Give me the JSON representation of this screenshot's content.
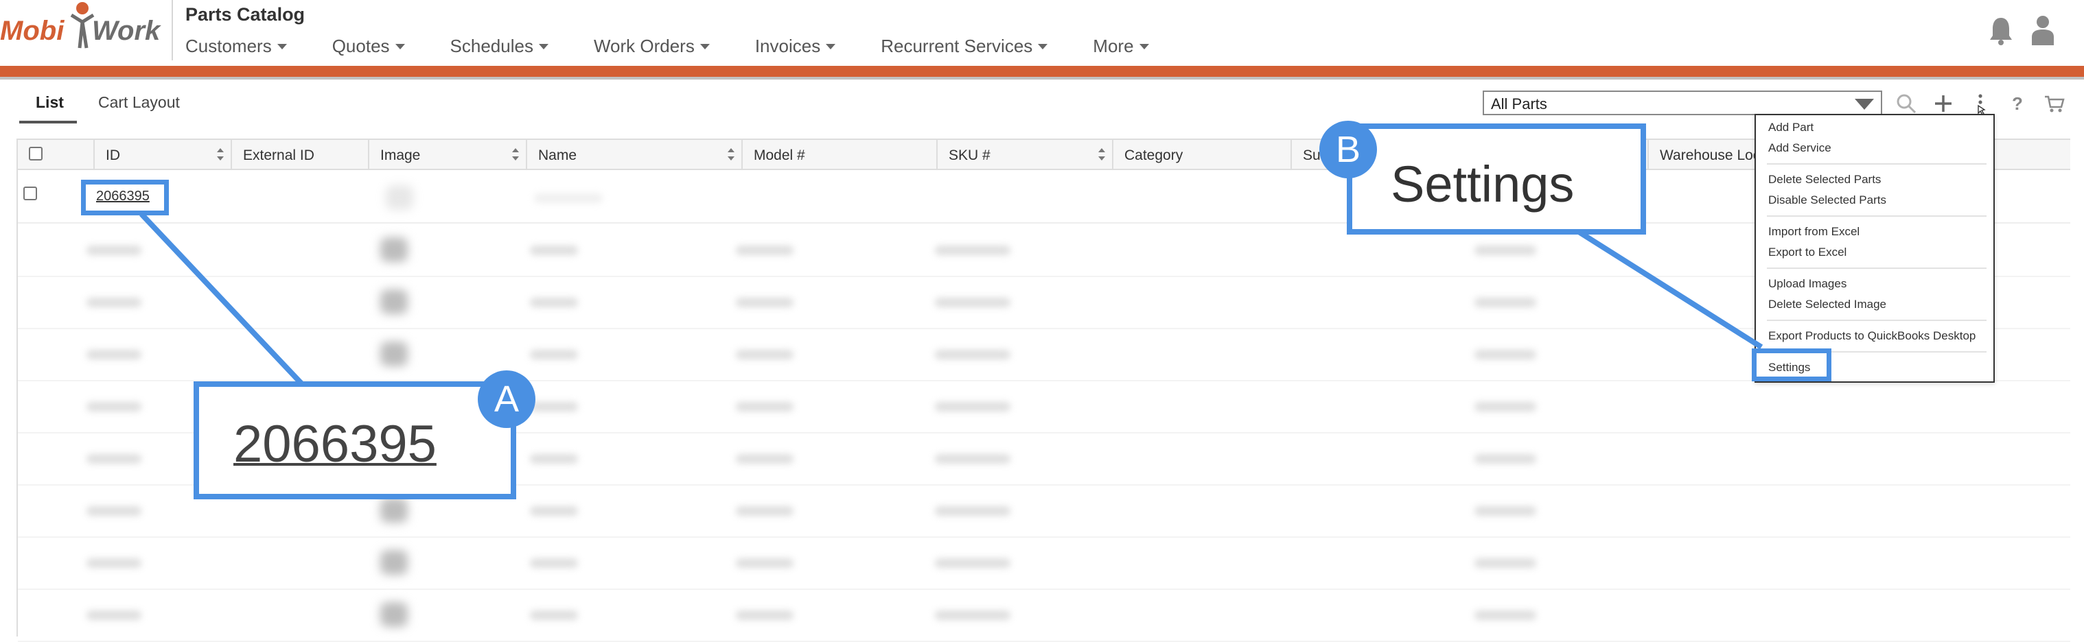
{
  "header": {
    "logo_text_left": "Mobi",
    "logo_text_right": "Work",
    "page_title": "Parts Catalog",
    "nav": [
      "Customers",
      "Quotes",
      "Schedules",
      "Work Orders",
      "Invoices",
      "Recurrent Services",
      "More"
    ]
  },
  "toolbar": {
    "tabs": [
      "List",
      "Cart Layout"
    ],
    "filter_value": "All Parts",
    "icons": [
      "search-icon",
      "plus-icon",
      "more-vertical-icon",
      "help-icon",
      "cart-icon"
    ]
  },
  "table": {
    "columns": [
      "ID",
      "External ID",
      "Image",
      "Name",
      "Model #",
      "SKU #",
      "Category",
      "Sub",
      "Warehouse Locati"
    ],
    "first_row_id": "2066395"
  },
  "menu": {
    "items": [
      "Add Part",
      "Add Service",
      "Delete Selected Parts",
      "Disable Selected Parts",
      "Import from Excel",
      "Export to Excel",
      "Upload Images",
      "Delete Selected Image",
      "Export Products to QuickBooks Desktop",
      "Settings"
    ]
  },
  "callouts": {
    "a_badge": "A",
    "a_text": "2066395",
    "b_badge": "B",
    "b_text": "Settings"
  },
  "colors": {
    "brand_orange": "#d35f34",
    "callout_blue": "#4a90e2"
  }
}
